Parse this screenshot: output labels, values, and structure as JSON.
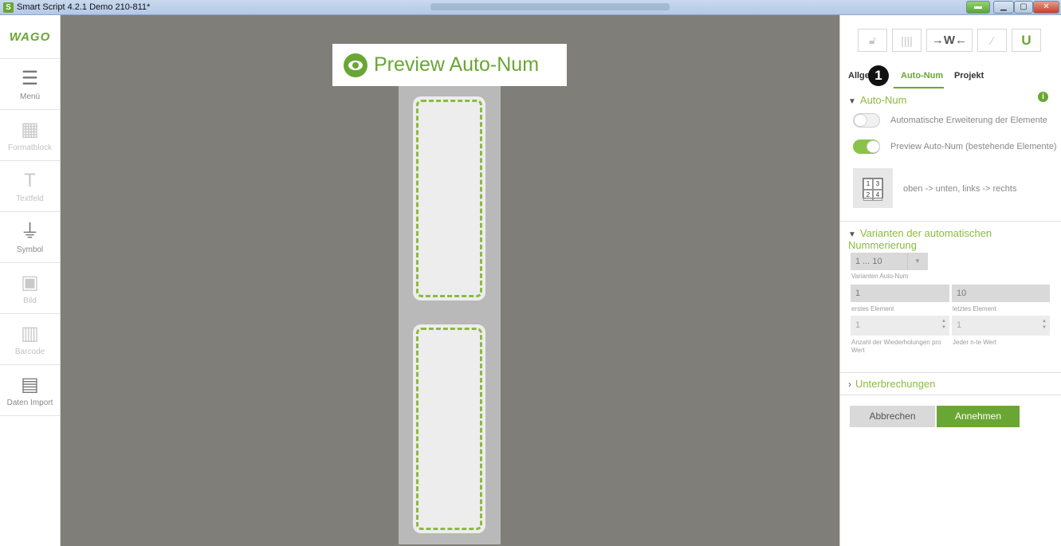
{
  "window": {
    "app_title": "Smart Script 4.2.1   Demo 210-811*",
    "app_icon": "S"
  },
  "sidebar": {
    "logo": "WAGO",
    "items": [
      {
        "label": "Menü",
        "icon": "hamburger-icon"
      },
      {
        "label": "Formatblock",
        "icon": "format-block-icon"
      },
      {
        "label": "Textfeld",
        "icon": "text-field-icon"
      },
      {
        "label": "Symbol",
        "icon": "ground-symbol-icon"
      },
      {
        "label": "Bild",
        "icon": "image-icon"
      },
      {
        "label": "Barcode",
        "icon": "barcode-icon"
      },
      {
        "label": "Daten Import",
        "icon": "data-import-icon"
      }
    ]
  },
  "canvas": {
    "preview_banner": "Preview Auto-Num"
  },
  "panel": {
    "toolbar": {
      "wide_label": "→W←"
    },
    "tabs": [
      "Allge",
      "Auto-Num",
      "Projekt"
    ],
    "badge": "1",
    "section_autonum": {
      "title": "Auto-Num",
      "toggle1_label": "Automatische Erweiterung der Elemente",
      "toggle1_on": false,
      "toggle2_label": "Preview Auto-Num (bestehende Elemente)",
      "toggle2_on": true,
      "order_grid": [
        "1",
        "3",
        "2",
        "4"
      ],
      "order_label": "oben -> unten, links -> rechts"
    },
    "section_variants": {
      "title": "Varianten der automatischen Nummerierung",
      "variant_value": "1 ... 10",
      "variant_caption": "Varianten Auto-Num",
      "first_value": "1",
      "first_caption": "erstes Element",
      "last_value": "10",
      "last_caption": "letztes Element",
      "repeat_value": "1",
      "repeat_caption": "Anzahl der Wiederholungen pro Wert",
      "nth_value": "1",
      "nth_caption": "Jeder n-te Wert"
    },
    "section_breaks": {
      "title": "Unterbrechungen"
    },
    "buttons": {
      "cancel": "Abbrechen",
      "ok": "Annehmen"
    }
  },
  "colors": {
    "accent": "#6aa633",
    "canvas_bg": "#7f7e79"
  }
}
